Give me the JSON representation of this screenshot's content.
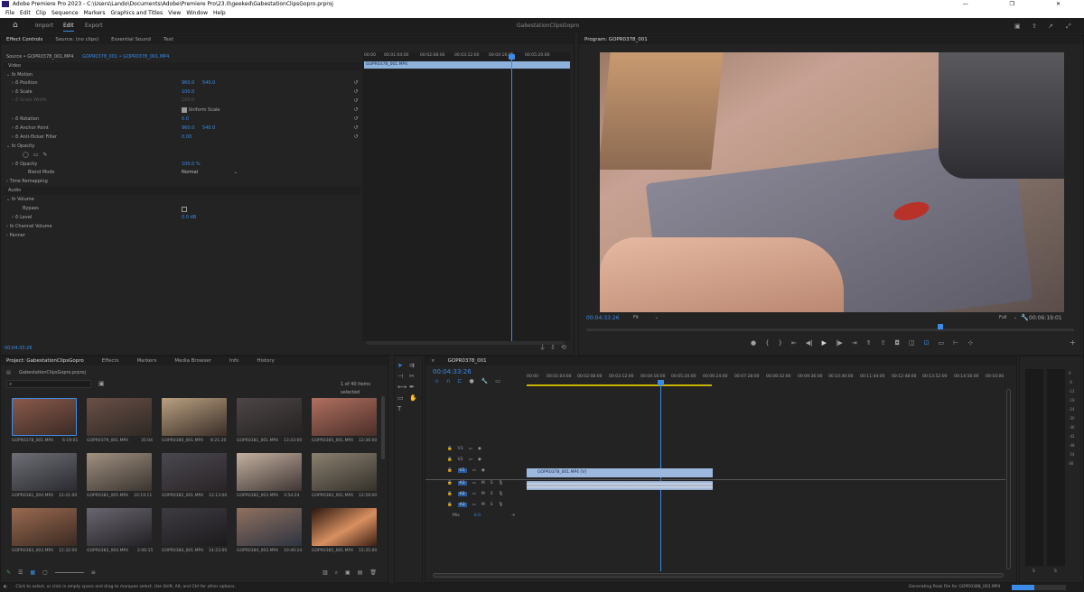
{
  "app": {
    "title": "Adobe Premiere Pro 2023 - C:\\Users\\Lando\\Documents\\Adobe\\Premiere Pro\\23.0\\geeked\\GabestationClipsGopro.prproj",
    "window_controls": [
      "—",
      "❐",
      "✕"
    ]
  },
  "menu": [
    "File",
    "Edit",
    "Clip",
    "Sequence",
    "Markers",
    "Graphics and Titles",
    "View",
    "Window",
    "Help"
  ],
  "workspace": {
    "tabs": [
      "Import",
      "Edit",
      "Export"
    ],
    "active_tab": "Edit",
    "project_name": "GabestationClipsGopro"
  },
  "effect_controls": {
    "tabs": [
      "Effect Controls",
      "Source: (no clips)",
      "Essential Sound",
      "Text"
    ],
    "source_label": "Source • GOPR0378_001.MP4",
    "clip_label": "GOPR0378_001 • GOPR0378_001.MP4",
    "timecodes": [
      "00:00",
      "00:01:04:00",
      "00:02:08:00",
      "00:03:12:00",
      "00:04:16:00",
      "00:05:20:00"
    ],
    "clip_bar": "GOPR0378_001.MP4",
    "section_video": "Video",
    "section_audio": "Audio",
    "motion": "Motion",
    "position_label": "Position",
    "position_x": "960.0",
    "position_y": "540.0",
    "scale_label": "Scale",
    "scale_value": "100.0",
    "scale_width_label": "Scale Width",
    "scale_width_value": "100.0",
    "uniform_scale": "Uniform Scale",
    "rotation_label": "Rotation",
    "rotation_value": "0.0",
    "anchor_label": "Anchor Point",
    "anchor_x": "960.0",
    "anchor_y": "540.0",
    "antiflicker_label": "Anti-flicker Filter",
    "antiflicker_value": "0.00",
    "opacity": "Opacity",
    "opacity_label": "Opacity",
    "opacity_value": "100.0 %",
    "blend_label": "Blend Mode",
    "blend_value": "Normal",
    "time_remapping": "Time Remapping",
    "volume": "Volume",
    "bypass_label": "Bypass",
    "level_label": "Level",
    "level_value": "0.0 dB",
    "channel_volume": "Channel Volume",
    "panner": "Panner",
    "current_time": "00:04:33:26"
  },
  "program": {
    "title": "Program: GOPR0378_001",
    "timecode": "00:04:33:26",
    "fit": "Fit",
    "quality": "Full",
    "duration": "00:06:19:01"
  },
  "project": {
    "tabs": [
      "Project: GabestationClipsGopro",
      "Effects",
      "Markers",
      "Media Browser",
      "Info",
      "History"
    ],
    "file": "GabestationClipsGopro.prproj",
    "items_label": "1 of 40 items selected",
    "items": [
      {
        "name": "GOPR0378_001.MP4",
        "dur": "6:19:01"
      },
      {
        "name": "GOPR0379_001.MP4",
        "dur": "35:04"
      },
      {
        "name": "GOPR0380_001.MP4",
        "dur": "8:21:20"
      },
      {
        "name": "GOPR0381_001.MP4",
        "dur": "13:43:00"
      },
      {
        "name": "GOPR0385_001.MP4",
        "dur": "12:36:00"
      },
      {
        "name": "GOPR0381_004.MP4",
        "dur": "12:41:00"
      },
      {
        "name": "GOPR0381_005.MP4",
        "dur": "10:19:11"
      },
      {
        "name": "GOPR0382_001.MP4",
        "dur": "12:13:00"
      },
      {
        "name": "GOPR0382_003.MP4",
        "dur": "3:54:24"
      },
      {
        "name": "GOPR0383_001.MP4",
        "dur": "12:59:00"
      },
      {
        "name": "GOPR0383_003.MP4",
        "dur": "12:32:00"
      },
      {
        "name": "GOPR0383_004.MP4",
        "dur": "2:06:15"
      },
      {
        "name": "GOPR0384_001.MP4",
        "dur": "14:23:00"
      },
      {
        "name": "GOPR0384_003.MP4",
        "dur": "10:40:24"
      },
      {
        "name": "GOPR0385_001.MP4",
        "dur": "15:35:00"
      }
    ]
  },
  "timeline": {
    "tab": "GOPR0378_001",
    "timecode": "00:04:33:26",
    "ruler": [
      "00:00",
      "00:01:04:00",
      "00:02:08:00",
      "00:03:12:00",
      "00:04:16:00",
      "00:05:20:00",
      "00:06:24:00",
      "00:07:28:00",
      "00:08:32:00",
      "00:09:36:00",
      "00:10:40:00",
      "00:11:44:00",
      "00:12:48:00",
      "00:13:52:00",
      "00:14:56:00",
      "00:16:00"
    ],
    "tracks": [
      "V3",
      "V2",
      "V1",
      "A1",
      "A2",
      "A3"
    ],
    "track_targets": [
      "V1",
      "A1",
      "A1",
      "A2"
    ],
    "video_clip": "GOPR0378_001.MP4 [V]",
    "mix_label": "Mix",
    "mix_value": "0.0",
    "track_flags": [
      "M",
      "S"
    ]
  },
  "meter": {
    "scale": [
      "0",
      "-6",
      "-12",
      "-18",
      "-24",
      "-30",
      "-36",
      "-42",
      "-48",
      "-54",
      "dB"
    ],
    "labels": [
      "S",
      "S"
    ]
  },
  "status": {
    "hint": "Click to select, or click in empty space and drag to marquee select. Use Shift, Alt, and Ctrl for other options.",
    "progress_text": "Generating Peak File for GOPR0388_003.MP4",
    "progress": 0.42
  }
}
